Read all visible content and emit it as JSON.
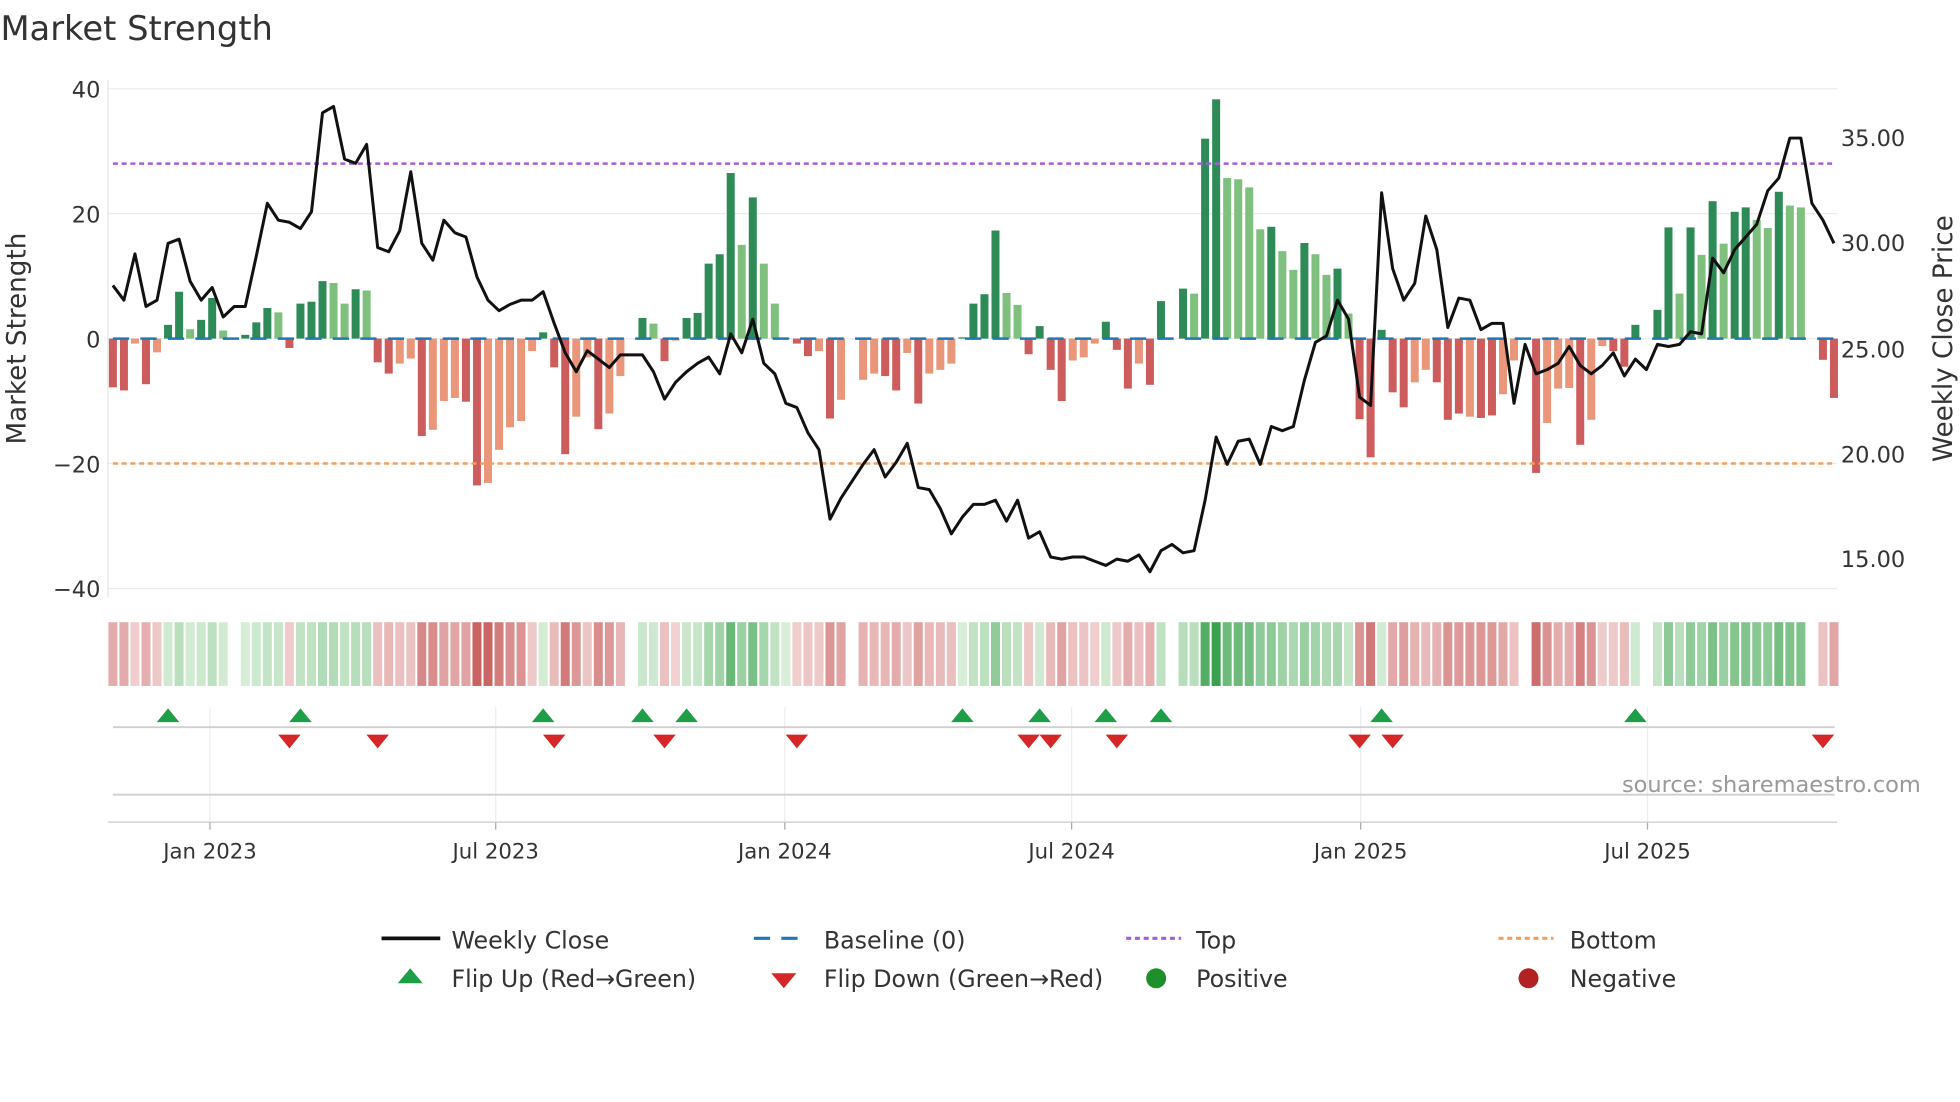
{
  "chart_data": {
    "type": "bar",
    "title": "Market Strength",
    "ylabel": "Market Strength",
    "y2label": "Weekly Close Price",
    "ylim": [
      -42,
      42
    ],
    "y2lim": [
      12.2,
      38.2
    ],
    "yticks": [
      "40",
      "20",
      "0",
      "−20",
      "−40"
    ],
    "ytick_values": [
      40,
      20,
      0,
      -20,
      -40
    ],
    "y2ticks": [
      "35.00",
      "30.00",
      "25.00",
      "20.00",
      "15.00"
    ],
    "y2tick_values": [
      35,
      30,
      25,
      20,
      15
    ],
    "xticks": [
      "Jan 2023",
      "Jul 2023",
      "Jan 2024",
      "Jul 2024",
      "Jan 2025",
      "Jul 2025"
    ],
    "xtick_week_index": [
      9.8,
      35.7,
      61.9,
      87.9,
      114.1,
      140.1
    ],
    "interval": "weekly",
    "top_level": 28,
    "bottom_level": -20,
    "baseline": 0,
    "grid": true,
    "legend_position": "bottom",
    "strength": [
      -7.8,
      -8.3,
      -0.8,
      -7.3,
      -2.2,
      2.2,
      7.5,
      1.5,
      3,
      6.5,
      1.3,
      0,
      0.6,
      2.6,
      4.9,
      4.2,
      -1.5,
      5.6,
      5.9,
      9.2,
      8.9,
      5.6,
      7.9,
      7.7,
      -3.8,
      -5.6,
      -4,
      -3.2,
      -15.6,
      -14.6,
      -10,
      -9.5,
      -10.1,
      -23.5,
      -23.1,
      -17.8,
      -14.2,
      -13.2,
      -2,
      1,
      -4.6,
      -18.5,
      -12.5,
      -3,
      -14.5,
      -12,
      -6,
      0,
      3.3,
      2.4,
      -3.6,
      -0.3,
      3.3,
      4.1,
      12,
      13.5,
      26.5,
      15,
      22.6,
      12,
      5.6,
      0.1,
      -0.8,
      -2.8,
      -2,
      -12.8,
      -9.8,
      0,
      -6.6,
      -5.6,
      -6,
      -8.3,
      -2.3,
      -10.4,
      -5.6,
      -5,
      -4,
      0.2,
      5.6,
      7.1,
      17.3,
      7.3,
      5.4,
      -2.5,
      2,
      -5,
      -10,
      -3.5,
      -3,
      -0.8,
      2.7,
      -1.8,
      -8,
      -4,
      -7.4,
      6,
      0,
      8,
      7.2,
      32,
      38.3,
      25.7,
      25.5,
      24.2,
      17.5,
      17.9,
      14,
      11,
      15.3,
      13.5,
      10.2,
      11.2,
      4,
      -12.9,
      -19,
      1.4,
      -8.6,
      -11,
      -7,
      -5,
      -7,
      -13,
      -12,
      -12.5,
      -12.7,
      -12.3,
      -8.9,
      -3.5,
      0,
      -21.5,
      -13.5,
      -8,
      -7.9,
      -17,
      -13,
      -1.2,
      -2,
      -4.5,
      2.2,
      0,
      4.6,
      17.8,
      7.2,
      17.8,
      13.4,
      22,
      15.2,
      20.3,
      21,
      19,
      17.7,
      23.5,
      21.3,
      21,
      0,
      -3.4,
      -9.5
    ],
    "shade": "DDLDLDDLDDLDDDDLDDDDLLDLDDLLDLLLDDLLLLLDDDLLDLLDDLDLDDDDDLDLLDDDLDLDLLDDLDLLLDDDDLLDDDDLLLDDDLDDDDLDDLLLLDLLDLLDLDDDDDLLDDDLDDLLLDLLLDLLDDDDDDLDLDLDDLLDLLDDD",
    "close": [
      28.0,
      27.3,
      29.5,
      27.0,
      27.3,
      30.0,
      30.2,
      28.2,
      27.3,
      27.9,
      26.5,
      27.0,
      27.0,
      29.4,
      31.9,
      31.1,
      31.0,
      30.7,
      31.5,
      36.2,
      36.5,
      34.0,
      33.8,
      34.7,
      29.8,
      29.6,
      30.6,
      33.4,
      30.0,
      29.2,
      31.1,
      30.5,
      30.3,
      28.4,
      27.3,
      26.8,
      27.1,
      27.3,
      27.3,
      27.7,
      26.2,
      24.8,
      23.9,
      24.9,
      24.5,
      24.1,
      24.7,
      24.7,
      24.7,
      23.9,
      22.6,
      23.4,
      23.9,
      24.3,
      24.6,
      23.8,
      25.7,
      24.8,
      26.4,
      24.3,
      23.8,
      22.4,
      22.2,
      21.0,
      20.2,
      16.9,
      17.9,
      18.7,
      19.5,
      20.2,
      18.9,
      19.6,
      20.5,
      18.4,
      18.3,
      17.4,
      16.2,
      17.0,
      17.6,
      17.6,
      17.8,
      16.8,
      17.8,
      16.0,
      16.3,
      15.1,
      15.0,
      15.1,
      15.1,
      14.9,
      14.7,
      15.0,
      14.9,
      15.2,
      14.4,
      15.4,
      15.7,
      15.3,
      15.4,
      17.8,
      20.8,
      19.5,
      20.6,
      20.7,
      19.5,
      21.3,
      21.1,
      21.3,
      23.5,
      25.3,
      25.6,
      27.3,
      26.4,
      22.7,
      22.3,
      32.4,
      28.8,
      27.3,
      28.1,
      31.3,
      29.7,
      26.0,
      27.4,
      27.3,
      25.9,
      26.2,
      26.2,
      22.4,
      25.2,
      23.8,
      24.0,
      24.3,
      25.1,
      24.2,
      23.8,
      24.2,
      24.8,
      23.7,
      24.5,
      24.0,
      25.2,
      25.1,
      25.2,
      25.8,
      25.7,
      29.3,
      28.6,
      29.7,
      30.3,
      30.9,
      32.5,
      33.1,
      35.0,
      35.0,
      31.9,
      31.1,
      30.0
    ],
    "flip_up_week_index": [
      6,
      18,
      40,
      49,
      53,
      78,
      85,
      91,
      96,
      116,
      139
    ],
    "flip_down_week_index": [
      17,
      25,
      41,
      51,
      63,
      84,
      86,
      92,
      114,
      117,
      156
    ],
    "colors": {
      "pos_strong": "#2e8b57",
      "pos_weak": "#7fc07f",
      "neg_strong": "#cd5c5c",
      "neg_weak": "#e9967a",
      "close": "#111111",
      "baseline": "#1f77b4",
      "top": "#a35ee0",
      "bottom": "#f0a060",
      "flip_up": "#1e9e46",
      "flip_down": "#d62728",
      "positive": "#1e8f2a",
      "negative": "#b22222"
    },
    "source": "source: sharemaestro.com",
    "legend": {
      "weekly_close": "Weekly Close",
      "baseline": "Baseline (0)",
      "top": "Top",
      "bottom": "Bottom",
      "flip_up": "Flip Up (Red→Green)",
      "flip_down": "Flip Down (Green→Red)",
      "positive": "Positive",
      "negative": "Negative"
    }
  }
}
